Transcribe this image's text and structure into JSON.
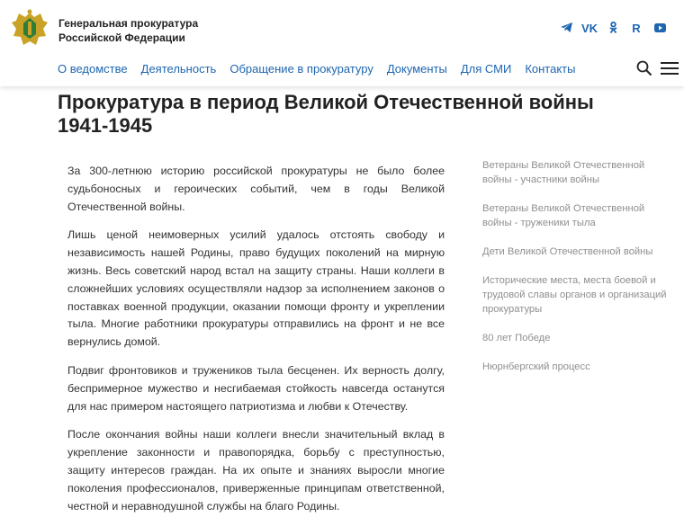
{
  "header": {
    "org_line1": "Генеральная прокуратура",
    "org_line2": "Российской Федерации",
    "social": [
      "telegram-icon",
      "vk-icon",
      "ok-icon",
      "rutube-icon",
      "youtube-icon"
    ],
    "social_labels": {
      "vk": "VK",
      "rutube": "R"
    },
    "nav": [
      "О ведомстве",
      "Деятельность",
      "Обращение в прокуратуру",
      "Документы",
      "Для СМИ",
      "Контакты"
    ]
  },
  "page": {
    "title": "Прокуратура в период Великой Отечественной войны 1941-1945",
    "paragraphs": [
      "За 300-летнюю историю российской прокуратуры не было более судьбоносных и героических событий, чем в годы Великой Отечественной войны.",
      "Лишь ценой неимоверных усилий удалось отстоять свободу и независимость нашей Родины, право будущих поколений на мирную жизнь. Весь советский народ встал на защиту страны. Наши коллеги в сложнейших условиях осуществляли надзор за исполнением законов о поставках военной продукции, оказании помощи фронту и укреплении тыла. Многие работники прокуратуры отправились на фронт и не все вернулись домой.",
      "Подвиг фронтовиков и тружеников тыла бесценен. Их верность долгу, беспримерное мужество и несгибаемая стойкость навсегда останутся для нас примером настоящего патриотизма и любви к Отечеству.",
      "После окончания войны наши коллеги внесли значительный вклад в укрепление законности и правопорядка, борьбу с преступностью, защиту интересов граждан. На их опыте и знаниях выросли многие поколения профессионалов, приверженные принципам ответственной, честной и неравнодушной службы на благо Родины."
    ]
  },
  "sidebar": {
    "links": [
      "Ветераны Великой Отечественной войны - участники войны",
      "Ветераны Великой Отечественной войны - труженики тыла",
      "Дети Великой Отечественной войны",
      "Исторические места, места боевой и трудовой славы органов и организаций прокуратуры",
      "80 лет Победе",
      "Нюрнбергский процесс"
    ]
  },
  "colors": {
    "accent": "#1d66b0",
    "text": "#222222",
    "muted": "#8f8f8f"
  }
}
